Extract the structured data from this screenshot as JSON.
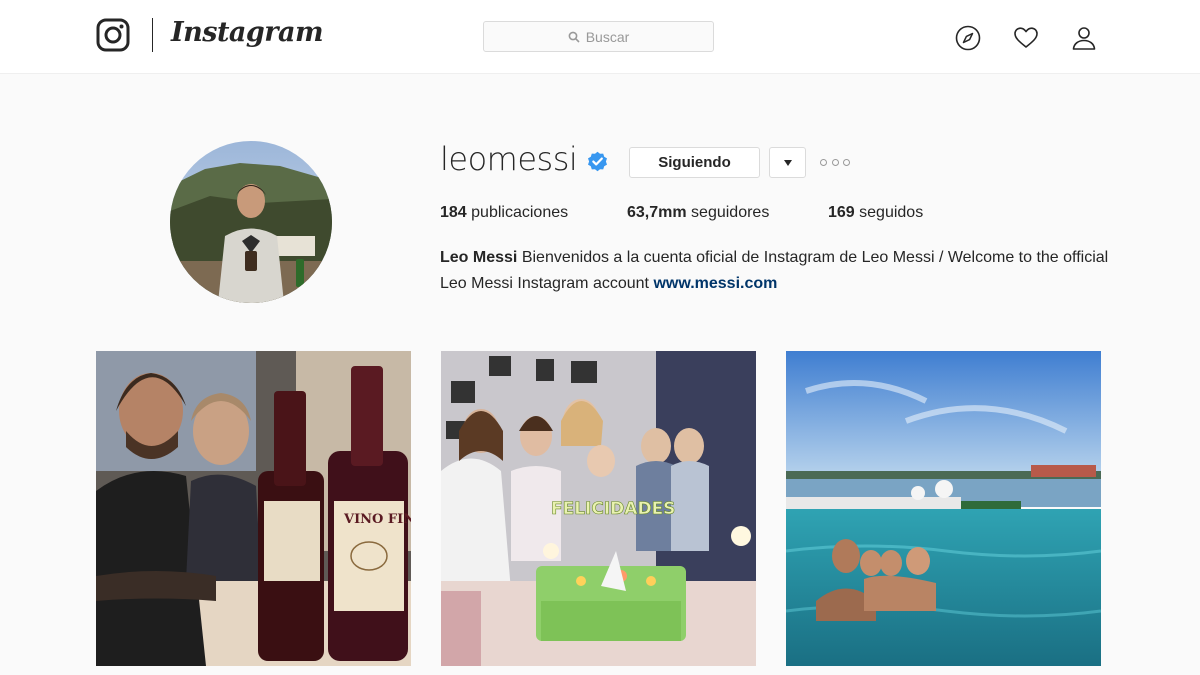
{
  "header": {
    "logo_text": "Instagram",
    "search_placeholder": "Buscar",
    "icons": [
      "instagram-glyph-icon",
      "search-icon",
      "compass-icon",
      "heart-icon",
      "user-icon"
    ]
  },
  "profile": {
    "username": "leomessi",
    "verified": true,
    "follow_button_label": "Siguiendo",
    "stats": {
      "posts_count": "184",
      "posts_label": "publicaciones",
      "followers_count": "63,7mm",
      "followers_label": "seguidores",
      "following_count": "169",
      "following_label": "seguidos"
    },
    "bio": {
      "full_name": "Leo Messi",
      "text": "Bienvenidos a la cuenta oficial de Instagram de Leo Messi / Welcome to the official Leo Messi Instagram account",
      "link": "www.messi.com"
    }
  },
  "posts": [
    {
      "index": 1,
      "visible_text": [
        "VINO FINO"
      ]
    },
    {
      "index": 2,
      "visible_text": [
        "FELICIDADES"
      ]
    },
    {
      "index": 3,
      "visible_text": []
    }
  ],
  "colors": {
    "verified_blue": "#3897f0",
    "link": "#003569",
    "border": "#dbdbdb",
    "background": "#fafafa"
  }
}
